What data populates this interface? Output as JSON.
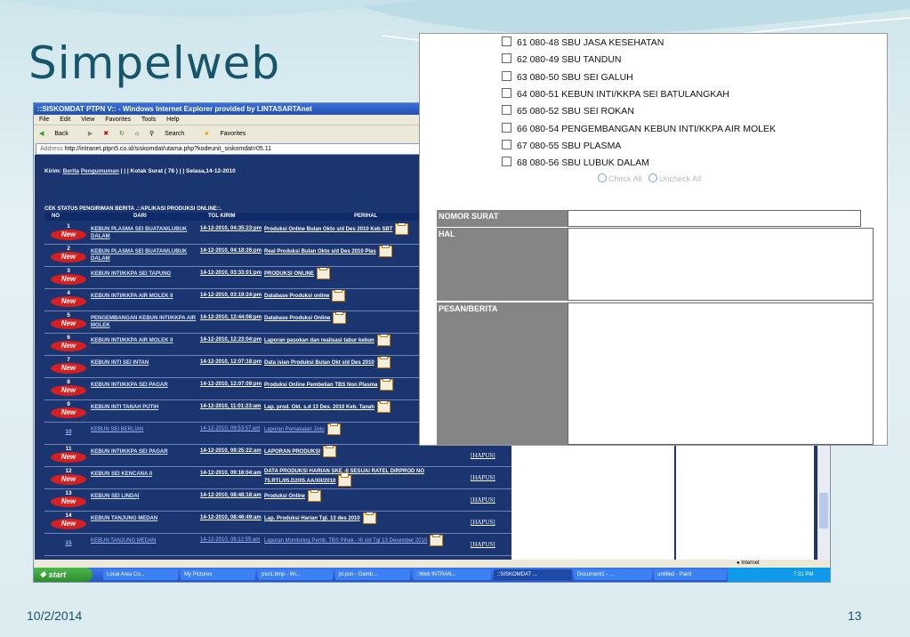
{
  "slide": {
    "title": "Simpelweb",
    "date": "10/2/2014",
    "page_number": "13"
  },
  "browser": {
    "window_title": "::SISKOMDAT PTPN V:: - Windows Internet Explorer provided by LINTASARTAnet",
    "menu": [
      "File",
      "Edit",
      "View",
      "Favorites",
      "Tools",
      "Help"
    ],
    "toolbar": [
      "Back",
      "Search",
      "Favorites"
    ],
    "address_label": "Address",
    "address": "http://intranet.ptpn5.co.id/siskomdat/utama.php?kodeunit_siskomdat=05.11",
    "status_zone": "Internet"
  },
  "page": {
    "kirim_text": "Kirim:",
    "kirim_links": [
      "Berita",
      "Pengumuman"
    ],
    "kirim_rest": "| | | Kotak Surat ( 78 ) | | Selasa,14-12-2010",
    "cek_status": "CEK STATUS PENGIRIMAN BERITA .::APLIKASI PRODUKSI ONLINE::.",
    "columns": [
      "NO",
      "DARI",
      "TGL KIRIM",
      "PERIHAL"
    ],
    "new_badge": "New",
    "hapus_label": "[HAPUS]",
    "rows": [
      {
        "no": "1",
        "dari": "KEBUN PLASMA SEI BUATAN/LUBUK DALAM",
        "tgl": "14-12-2010, 04:35:23:pm",
        "perihal": "Produksi Online Bulan Okto s/d Des 2010 Keb SBT"
      },
      {
        "no": "2",
        "dari": "KEBUN PLASMA SEI BUATAN/LUBUK DALAM",
        "tgl": "14-12-2010, 04:18:26:pm",
        "perihal": "Real Produksi Bulan Okto s/d Des 2010 Plas"
      },
      {
        "no": "3",
        "dari": "KEBUN INTI/KKPA SEI TAPUNG",
        "tgl": "14-12-2010, 03:33:01:pm",
        "perihal": "PRODUKSI ONLINE"
      },
      {
        "no": "4",
        "dari": "KEBUN INTI/KKPA AIR MOLEK II",
        "tgl": "14-12-2010, 03:19:24:pm",
        "perihal": "Database  Produksi  online"
      },
      {
        "no": "5",
        "dari": "PENGEMBANGAN KEBUN INTI/KKPA AIR MOLEK",
        "tgl": "14-12-2010, 12:44:08:pm",
        "perihal": "Database Produksi Online"
      },
      {
        "no": "6",
        "dari": "KEBUN INTI/KKPA AIR MOLEK II",
        "tgl": "14-12-2010, 12:23:04:pm",
        "perihal": "Laporan pasokan dan realisasi tabur kebun"
      },
      {
        "no": "7",
        "dari": "KEBUN INTI SEI INTAN",
        "tgl": "14-12-2010, 12:07:18:pm",
        "perihal": "Data isian Produksi Bulan Okt s/d Des 2010"
      },
      {
        "no": "8",
        "dari": "KEBUN INTI/KKPA SEI PAGAR",
        "tgl": "14-12-2010, 12:07:09:pm",
        "perihal": "Produksi Online Pembelian TBS Non Plasma"
      },
      {
        "no": "9",
        "dari": "KEBUN INTI TANAH PUTIH",
        "tgl": "14-12-2010, 11:01:23:am",
        "perihal": "Lap. prod. Okt. s.d 13 Des. 2010 Keb. Tanah"
      },
      {
        "no": "10",
        "dari": "KEBUN SEI BERLIAN",
        "tgl": "14-12-2010, 09:53:57:am",
        "perihal": "Laporan Pemakaian Jinlu"
      },
      {
        "no": "11",
        "dari": "KEBUN INTI/KKPA SEI PAGAR",
        "tgl": "14-12-2010, 09:25:22:am",
        "perihal": "LAPORAN PRODUKSI"
      },
      {
        "no": "12",
        "dari": "KEBUN SEI KENCANA II",
        "tgl": "14-12-2010, 09:16:04:am",
        "perihal": "DATA PRODUKSI HARIAN SKE -II SESUAI RATEL DIRPROD NO 75.RTL/05.D2/05.AA/XII/2010"
      },
      {
        "no": "13",
        "dari": "KEBUN SEI LINDAI",
        "tgl": "14-12-2010, 08:48:18:am",
        "perihal": "Produksi Online"
      },
      {
        "no": "14",
        "dari": "KEBUN TANJUNG MEDAN",
        "tgl": "14-12-2010, 08:46:49:am",
        "perihal": "Lap. Produksi Harian Tgl. 13 des 2010"
      },
      {
        "no": "15",
        "dari": "KEBUN TANJUNG MEDAN",
        "tgl": "14-12-2010, 08:12:55:am",
        "perihal": "Laporan Monitoring Pemb. TBS Pihak - III s/d Tgl 13 Desember 2010"
      }
    ]
  },
  "taskbar": {
    "start": "start",
    "tasks": [
      "Local Area Co...",
      "My Pictures",
      "psn1.bmp - Wi...",
      "pt.psn - Gamb...",
      "::Web INTRAN...",
      "::SISKOMDAT ...",
      "Document1 - ...",
      "untitled - Paint"
    ],
    "clock": "7:31 PM"
  },
  "form": {
    "units": [
      "61  080-48 SBU JASA KESEHATAN",
      "62  080-49 SBU TANDUN",
      "63  080-50 SBU SEI GALUH",
      "64  080-51 KEBUN INTI/KKPA SEI BATULANGKAH",
      "65  080-52 SBU SEI ROKAN",
      "66  080-54 PENGEMBANGAN KEBUN INTI/KKPA AIR MOLEK",
      "67  080-55 SBU PLASMA",
      "68  080-56 SBU LUBUK DALAM"
    ],
    "check_all": "Check All",
    "uncheck_all": "Uncheck All",
    "nomor_surat_label": "NOMOR SURAT",
    "hal_label": "HAL",
    "pesan_label": "PESAN/BERITA"
  },
  "colors": {
    "title": "#17556a",
    "page_bg": "#1a3570",
    "new_badge": "#d81e1e",
    "form_label_bg": "#858585"
  }
}
